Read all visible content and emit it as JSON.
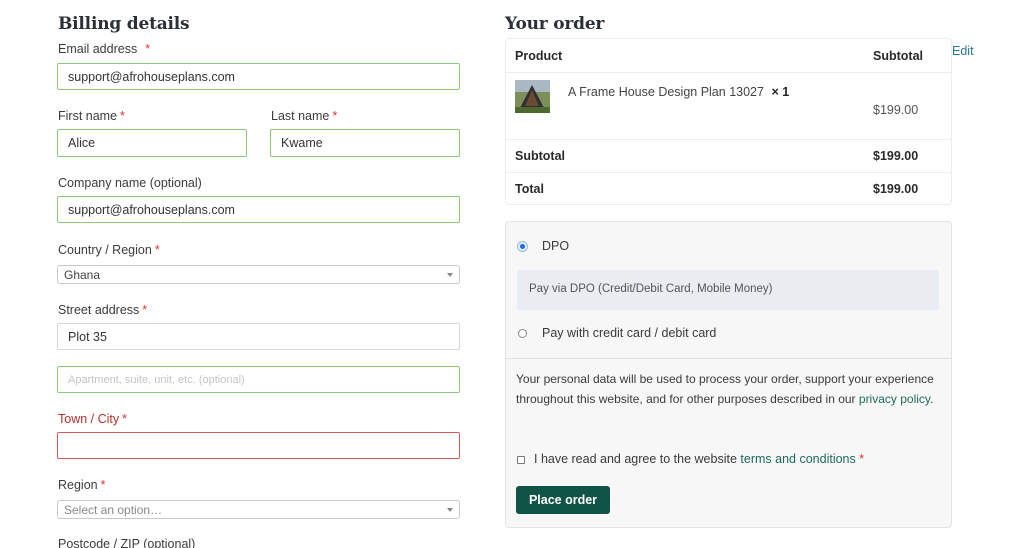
{
  "billing": {
    "title": "Billing details",
    "email_label": "Email address",
    "email_value": "support@afrohouseplans.com",
    "first_name_label": "First name",
    "first_name_value": "Alice",
    "last_name_label": "Last name",
    "last_name_value": "Kwame",
    "company_label": "Company name (optional)",
    "company_value": "support@afrohouseplans.com",
    "country_label": "Country / Region",
    "country_value": "Ghana",
    "street_label": "Street address",
    "street_value": "Plot 35",
    "apartment_placeholder": "Apartment, suite, unit, etc. (optional)",
    "town_label": "Town / City",
    "region_label": "Region",
    "region_placeholder": "Select an option…",
    "postcode_label": "Postcode / ZIP (optional)",
    "required_mark": "*"
  },
  "order": {
    "title": "Your order",
    "edit_link": "Edit",
    "col_product": "Product",
    "col_subtotal": "Subtotal",
    "item_name": "A Frame House Design Plan 13027",
    "item_qty": "× 1",
    "item_price": "$199.00",
    "subtotal_label": "Subtotal",
    "subtotal_value": "$199.00",
    "total_label": "Total",
    "total_value": "$199.00"
  },
  "payment": {
    "option1_label": "DPO",
    "option1_desc": "Pay via DPO (Credit/Debit Card, Mobile Money)",
    "option2_label": "Pay with credit card / debit card",
    "privacy_text": "Your personal data will be used to process your order, support your experience throughout this website, and for other purposes described in our",
    "privacy_link": "privacy policy",
    "privacy_end": ".",
    "terms_text": "I have read and agree to the website",
    "terms_link": "terms and conditions",
    "required_mark": "*",
    "place_order": "Place order"
  },
  "colors": {
    "field_valid_border": "#8cc97a",
    "field_error_border": "#d45b5b",
    "button_bg": "#0f5444",
    "link": "#1f6b5a",
    "required": "#d63638"
  },
  "icons": [
    "caret-down-icon",
    "radio-selected-icon",
    "radio-unselected-icon",
    "checkbox-icon",
    "product-thumbnail"
  ]
}
